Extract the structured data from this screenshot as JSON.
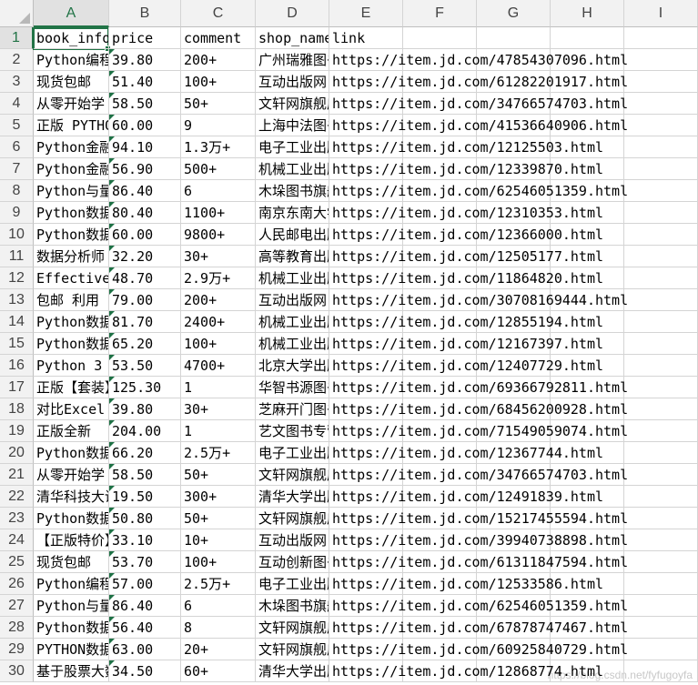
{
  "columns": [
    "A",
    "B",
    "C",
    "D",
    "E",
    "F",
    "G",
    "H",
    "I"
  ],
  "headers": [
    "book_info",
    "price",
    "comment",
    "shop_name",
    "link"
  ],
  "rows": [
    {
      "n": "2",
      "info": "Python编程",
      "price": "39.80",
      "comment": "200+",
      "shop": "广州瑞雅图书",
      "link": "https://item.jd.com/47854307096.html"
    },
    {
      "n": "3",
      "info": "现货包邮",
      "price": "51.40",
      "comment": "100+",
      "shop": "互动出版网",
      "link": "https://item.jd.com/61282201917.html"
    },
    {
      "n": "4",
      "info": "从零开始学",
      "price": "58.50",
      "comment": "50+",
      "shop": "文轩网旗舰店",
      "link": "https://item.jd.com/34766574703.html"
    },
    {
      "n": "5",
      "info": "正版 PYTHON",
      "price": "60.00",
      "comment": "9",
      "shop": "上海中法图书",
      "link": "https://item.jd.com/41536640906.html"
    },
    {
      "n": "6",
      "info": "Python金融",
      "price": "94.10",
      "comment": "1.3万+",
      "shop": "电子工业出版社",
      "link": "https://item.jd.com/12125503.html"
    },
    {
      "n": "7",
      "info": "Python金融",
      "price": "56.90",
      "comment": "500+",
      "shop": "机械工业出版社",
      "link": "https://item.jd.com/12339870.html"
    },
    {
      "n": "8",
      "info": "Python与量化",
      "price": "86.40",
      "comment": "6",
      "shop": "木垛图书旗舰店",
      "link": "https://item.jd.com/62546051359.html"
    },
    {
      "n": "9",
      "info": "Python数据",
      "price": "80.40",
      "comment": "1100+",
      "shop": "南京东南大学",
      "link": "https://item.jd.com/12310353.html"
    },
    {
      "n": "10",
      "info": "Python数据",
      "price": "60.00",
      "comment": "9800+",
      "shop": "人民邮电出版社",
      "link": "https://item.jd.com/12366000.html"
    },
    {
      "n": "11",
      "info": "数据分析师",
      "price": "32.20",
      "comment": "30+",
      "shop": "高等教育出版社",
      "link": "https://item.jd.com/12505177.html"
    },
    {
      "n": "12",
      "info": "Effective Python",
      "price": "48.70",
      "comment": "2.9万+",
      "shop": "机械工业出版社",
      "link": "https://item.jd.com/11864820.html"
    },
    {
      "n": "13",
      "info": "包邮 利用",
      "price": "79.00",
      "comment": "200+",
      "shop": "互动出版网",
      "link": "https://item.jd.com/30708169444.html"
    },
    {
      "n": "14",
      "info": "Python数据",
      "price": "81.70",
      "comment": "2400+",
      "shop": "机械工业出版社",
      "link": "https://item.jd.com/12855194.html"
    },
    {
      "n": "15",
      "info": "Python数据",
      "price": "65.20",
      "comment": "100+",
      "shop": "机械工业出版社",
      "link": "https://item.jd.com/12167397.html"
    },
    {
      "n": "16",
      "info": "Python 3",
      "price": "53.50",
      "comment": "4700+",
      "shop": "北京大学出版社",
      "link": "https://item.jd.com/12407729.html"
    },
    {
      "n": "17",
      "info": "正版【套装】",
      "price": "125.30",
      "comment": "1",
      "shop": "华智书源图书",
      "link": "https://item.jd.com/69366792811.html"
    },
    {
      "n": "18",
      "info": "对比Excel",
      "price": "39.80",
      "comment": "30+",
      "shop": "芝麻开门图书",
      "link": "https://item.jd.com/68456200928.html"
    },
    {
      "n": "19",
      "info": "正版全新",
      "price": "204.00",
      "comment": "1",
      "shop": "艺文图书专营店",
      "link": "https://item.jd.com/71549059074.html"
    },
    {
      "n": "20",
      "info": "Python数据",
      "price": "66.20",
      "comment": "2.5万+",
      "shop": "电子工业出版社",
      "link": "https://item.jd.com/12367744.html"
    },
    {
      "n": "21",
      "info": "从零开始学",
      "price": "58.50",
      "comment": "50+",
      "shop": "文轩网旗舰店",
      "link": "https://item.jd.com/34766574703.html"
    },
    {
      "n": "22",
      "info": "清华科技大讲堂",
      "price": "19.50",
      "comment": "300+",
      "shop": "清华大学出版社",
      "link": "https://item.jd.com/12491839.html"
    },
    {
      "n": "23",
      "info": "Python数据",
      "price": "50.80",
      "comment": "50+",
      "shop": "文轩网旗舰店",
      "link": "https://item.jd.com/15217455594.html"
    },
    {
      "n": "24",
      "info": "【正版特价】",
      "price": "33.10",
      "comment": "10+",
      "shop": "互动出版网",
      "link": "https://item.jd.com/39940738898.html"
    },
    {
      "n": "25",
      "info": "现货包邮",
      "price": "53.70",
      "comment": "100+",
      "shop": "互动创新图书",
      "link": "https://item.jd.com/61311847594.html"
    },
    {
      "n": "26",
      "info": "Python编程",
      "price": "57.00",
      "comment": "2.5万+",
      "shop": "电子工业出版社",
      "link": "https://item.jd.com/12533586.html"
    },
    {
      "n": "27",
      "info": "Python与量化",
      "price": "86.40",
      "comment": "6",
      "shop": "木垛图书旗舰店",
      "link": "https://item.jd.com/62546051359.html"
    },
    {
      "n": "28",
      "info": "Python数据",
      "price": "56.40",
      "comment": "8",
      "shop": "文轩网旗舰店",
      "link": "https://item.jd.com/67878747467.html"
    },
    {
      "n": "29",
      "info": "PYTHON数据",
      "price": "63.00",
      "comment": "20+",
      "shop": "文轩网旗舰店",
      "link": "https://item.jd.com/60925840729.html"
    },
    {
      "n": "30",
      "info": "基于股票大数据",
      "price": "34.50",
      "comment": "60+",
      "shop": "清华大学出版社",
      "link": "https://item.jd.com/12868774.html"
    }
  ],
  "watermark": "https://blog.csdn.net/fyfugoyfa",
  "colors": {
    "accent": "#217346",
    "grid": "#d4d4d4",
    "header_bg": "#f2f2f2"
  }
}
